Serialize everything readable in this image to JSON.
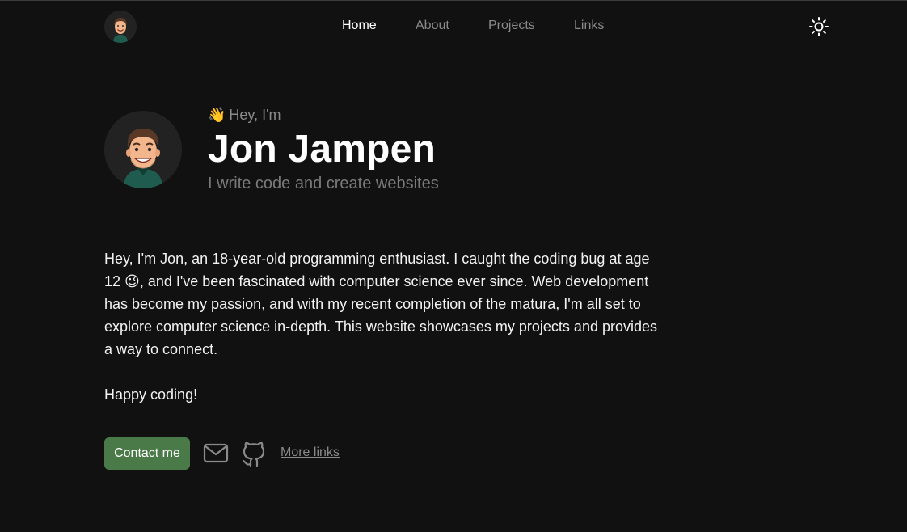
{
  "nav": {
    "avatar_icon": "memoji-avatar-icon",
    "links": [
      {
        "label": "Home",
        "active": true
      },
      {
        "label": "About",
        "active": false
      },
      {
        "label": "Projects",
        "active": false
      },
      {
        "label": "Links",
        "active": false
      }
    ],
    "theme_icon": "sun-icon"
  },
  "hero": {
    "greeting_emoji": "👋",
    "greeting": "Hey, I'm",
    "name": "Jon Jampen",
    "tagline": "I write code and create websites"
  },
  "bio": {
    "paragraph_1_part_1": "Hey, I'm Jon, an 18-year-old programming enthusiast. I caught the coding bug at age 12",
    "paragraph_1_emoji": "😉",
    "paragraph_1_part_2": ", and I've been fascinated with computer science ever since. Web development has become my passion, and with my recent completion of the matura, I'm all set to explore computer science in-depth. This website showcases my projects and provides a way to connect.",
    "paragraph_2": "Happy coding!"
  },
  "actions": {
    "contact_label": "Contact me",
    "mail_icon": "mail-icon",
    "github_icon": "github-icon",
    "more_links_label": "More links"
  },
  "colors": {
    "background": "#111111",
    "accent_button": "#4a7a48",
    "muted_text": "#8a8a8a"
  }
}
